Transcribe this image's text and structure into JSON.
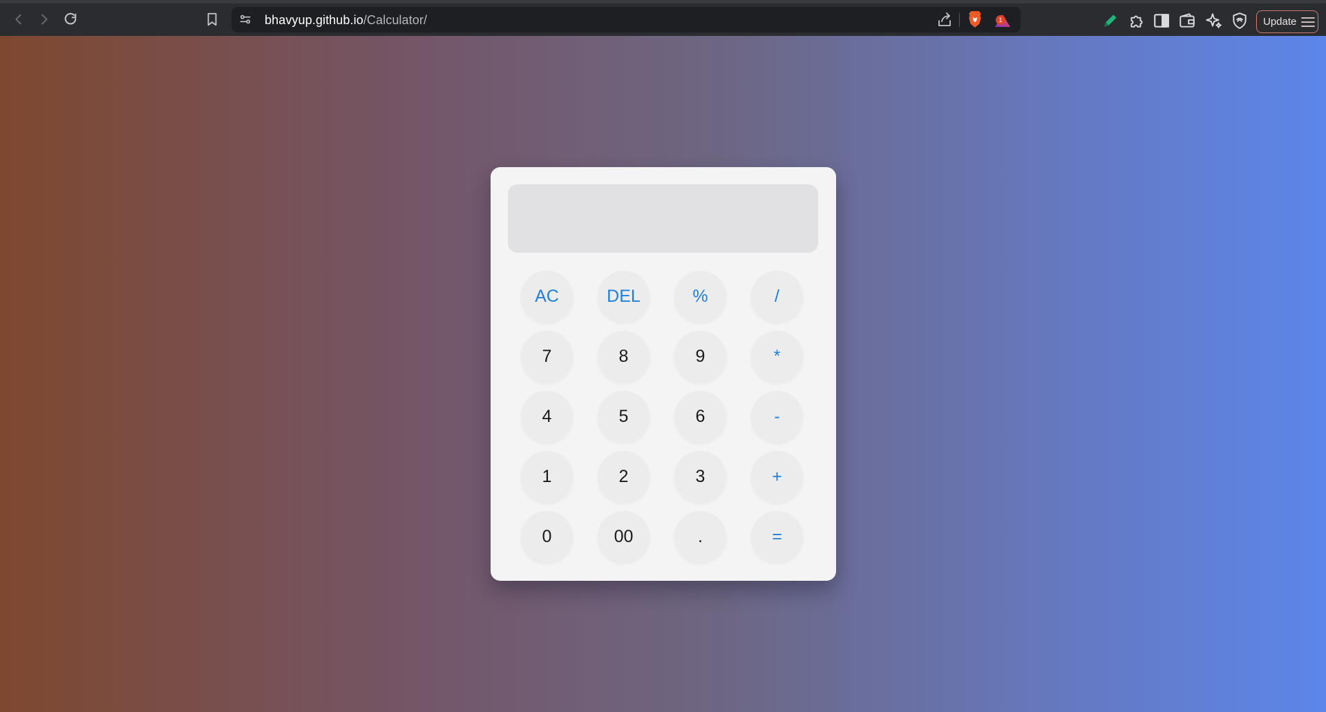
{
  "browser": {
    "url_host": "bhavyup.github.io",
    "url_path": "/Calculator/",
    "notification_badge": "1",
    "update_label": "Update",
    "icons": {
      "back": "back-arrow-icon",
      "forward": "forward-arrow-icon",
      "reload": "reload-icon",
      "bookmark": "bookmark-icon",
      "site_info": "site-settings-icon",
      "share": "share-icon",
      "brave_shields": "brave-lion-icon",
      "rewards": "brave-rewards-icon",
      "pen": "pen-icon",
      "extensions": "puzzle-icon",
      "sidebar": "sidebar-icon",
      "wallet": "wallet-icon",
      "leo": "ai-sparkle-icon",
      "vpn": "vpn-shield-icon",
      "menu": "hamburger-menu-icon"
    }
  },
  "calculator": {
    "display_value": "",
    "keys": [
      {
        "label": "AC",
        "kind": "op"
      },
      {
        "label": "DEL",
        "kind": "op"
      },
      {
        "label": "%",
        "kind": "op"
      },
      {
        "label": "/",
        "kind": "op"
      },
      {
        "label": "7",
        "kind": "num"
      },
      {
        "label": "8",
        "kind": "num"
      },
      {
        "label": "9",
        "kind": "num"
      },
      {
        "label": "*",
        "kind": "op"
      },
      {
        "label": "4",
        "kind": "num"
      },
      {
        "label": "5",
        "kind": "num"
      },
      {
        "label": "6",
        "kind": "num"
      },
      {
        "label": "-",
        "kind": "op"
      },
      {
        "label": "1",
        "kind": "num"
      },
      {
        "label": "2",
        "kind": "num"
      },
      {
        "label": "3",
        "kind": "num"
      },
      {
        "label": "+",
        "kind": "op"
      },
      {
        "label": "0",
        "kind": "num"
      },
      {
        "label": "00",
        "kind": "num"
      },
      {
        "label": ".",
        "kind": "num"
      },
      {
        "label": "=",
        "kind": "op"
      }
    ]
  },
  "colors": {
    "operator_key_text": "#1f7fd6",
    "number_key_text": "#1a1a1a",
    "gradient_start": "#7e482f",
    "gradient_end": "#5c86ea"
  }
}
